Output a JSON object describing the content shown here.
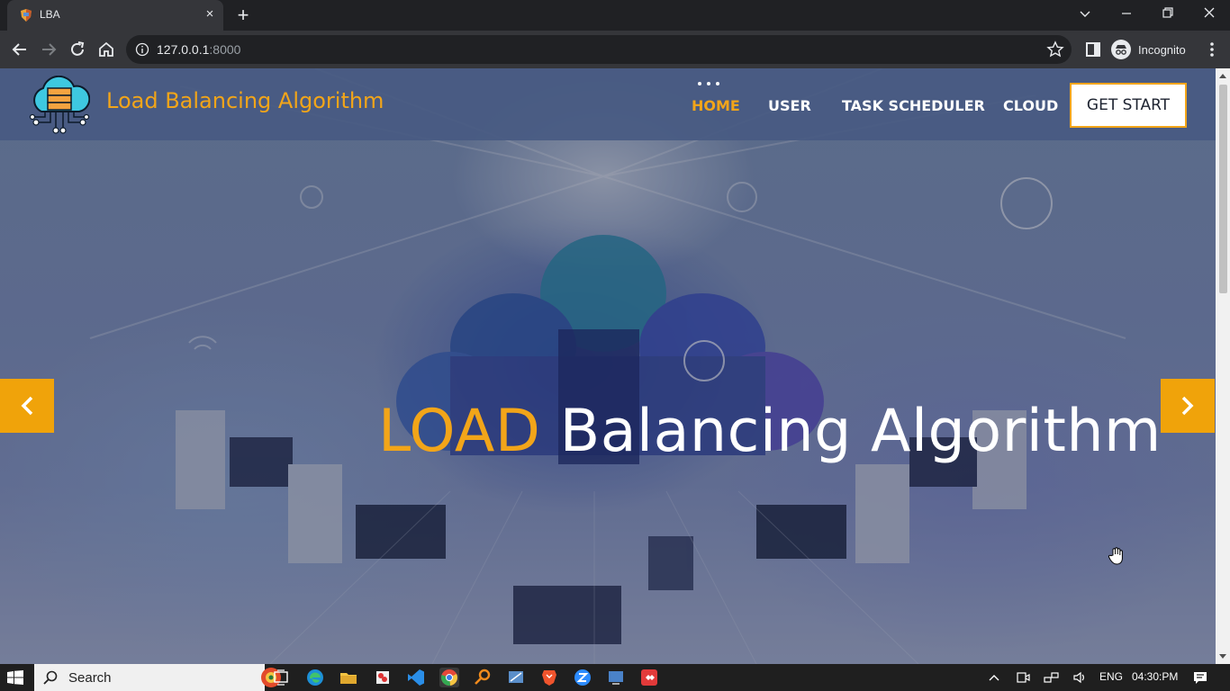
{
  "browser": {
    "tab_title": "LBA",
    "tab_close": "×",
    "new_tab": "+",
    "url_host": "127.0.0.1",
    "url_port": ":8000",
    "profile_label": "Incognito",
    "window_controls": [
      "chevron-down-icon",
      "minimize-icon",
      "restore-icon",
      "close-icon"
    ]
  },
  "site": {
    "brand": "Load Balancing Algorithm",
    "nav": [
      {
        "label": "HOME",
        "active": true
      },
      {
        "label": "USER",
        "active": false
      },
      {
        "label": "TASK SCHEDULER",
        "active": false
      },
      {
        "label": "CLOUD",
        "active": false
      }
    ],
    "cta": "GET START",
    "hero_accent": "LOAD",
    "hero_rest": "Balancing Algorithm",
    "colors": {
      "accent": "#f2a519",
      "navbar": "#485a82",
      "arrow": "#f0a30a"
    }
  },
  "taskbar": {
    "search_placeholder": "Search",
    "apps": [
      "task-view-icon",
      "edge-icon",
      "file-explorer-icon",
      "app-icon",
      "vscode-icon",
      "chrome-icon",
      "search-app-icon",
      "app-icon",
      "brave-icon",
      "zoom-icon",
      "app-icon",
      "anydesk-icon"
    ],
    "language": "ENG",
    "time": "04:30:PM"
  }
}
